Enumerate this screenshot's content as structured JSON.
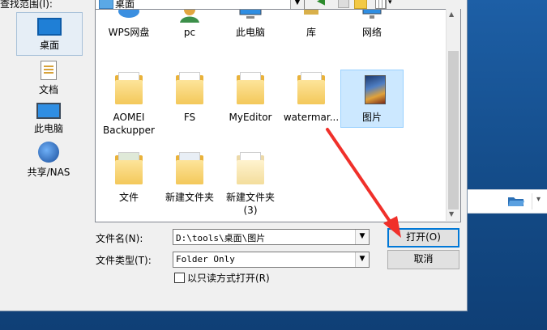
{
  "dialog": {
    "look_in_label": "查找范围(I):",
    "look_in_value": "桌面"
  },
  "places": [
    {
      "label": "桌面",
      "icon": "desktop-icon",
      "selected": true
    },
    {
      "label": "文档",
      "icon": "documents-icon"
    },
    {
      "label": "此电脑",
      "icon": "computer-icon"
    },
    {
      "label": "共享/NAS",
      "icon": "network-globe-icon"
    }
  ],
  "files": [
    {
      "label": "WPS网盘",
      "icon": "wps-cloud-icon"
    },
    {
      "label": "pc",
      "icon": "user-icon"
    },
    {
      "label": "此电脑",
      "icon": "computer-icon"
    },
    {
      "label": "库",
      "icon": "library-icon"
    },
    {
      "label": "网络",
      "icon": "network-icon"
    },
    {
      "label": "AOMEI Backupper",
      "label_line1": "AOMEI",
      "label_line2": "Backupper",
      "icon": "folder-icon"
    },
    {
      "label": "FS",
      "icon": "folder-icon"
    },
    {
      "label": "MyEditor",
      "icon": "folder-icon"
    },
    {
      "label": "watermar...",
      "icon": "folder-icon"
    },
    {
      "label": "图片",
      "icon": "image-folder-icon",
      "selected": true
    },
    {
      "label": "文件",
      "icon": "folder-icon"
    },
    {
      "label": "新建文件夹",
      "icon": "folder-icon"
    },
    {
      "label": "新建文件夹 (3)",
      "label_line1": "新建文件夹",
      "label_line2": "(3)",
      "icon": "folder-icon"
    }
  ],
  "form": {
    "filename_label": "文件名(N):",
    "filename_value": "D:\\tools\\桌面\\图片",
    "filetype_label": "文件类型(T):",
    "filetype_value": "Folder Only",
    "readonly_label": "以只读方式打开(R)",
    "readonly_checked": false,
    "open_button": "打开(O)",
    "cancel_button": "取消"
  },
  "colors": {
    "annotation_arrow": "#f0302a",
    "selection": "#cce8ff",
    "desktop_background": "#16528f"
  }
}
